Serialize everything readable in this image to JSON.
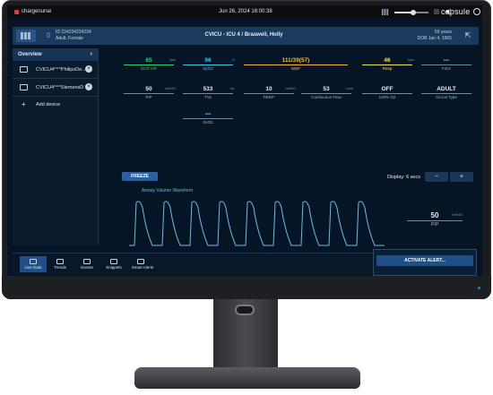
{
  "topbar": {
    "user": "chargenurse",
    "datetime": "Jun 26, 2024  16:00:38",
    "brand": "capsule",
    "brightness_fraction": 0.55
  },
  "patient": {
    "id_line": "ID 234234234234",
    "demo_line": "Adult, Female",
    "location": "CVICU - ICU 4 / Braswell, Holly",
    "age": "59 years",
    "dob": "DOB Jan 4, 1965"
  },
  "sidebar": {
    "title": "Overview",
    "devices": [
      {
        "label": "CVICU4^^^PhilipsDe..."
      },
      {
        "label": "CVICU4^^^SiemensD"
      }
    ],
    "add_label": "Add device"
  },
  "vitals": [
    {
      "value": "65",
      "unit": "bpm",
      "label": "ECG HR",
      "color": "green"
    },
    {
      "value": "96",
      "unit": "%",
      "label": "SpO2",
      "color": "cyan"
    },
    {
      "value": "111/39(57)",
      "unit": "",
      "label": "NIBP",
      "color": "orange"
    },
    {
      "value": "46",
      "unit": "bpm",
      "label": "Resp",
      "color": "yellow"
    },
    {
      "value": "---",
      "unit": "",
      "label": "FiO2",
      "color": ""
    },
    {
      "value": "50",
      "unit": "cmH2O",
      "label": "PIP",
      "color": ""
    },
    {
      "value": "533",
      "unit": "mL",
      "label": "TVe",
      "color": ""
    },
    {
      "value": "10",
      "unit": "cmH2O",
      "label": "PEEP",
      "color": ""
    },
    {
      "value": "53",
      "unit": "L/min",
      "label": "Continuous Flow",
      "color": ""
    },
    {
      "value": "OFF",
      "unit": "",
      "label": "100% O2",
      "color": ""
    },
    {
      "value": "ADULT",
      "unit": "",
      "label": "Circuit Type",
      "color": ""
    },
    {
      "value": "---",
      "unit": "",
      "label": "SvO2",
      "color": ""
    }
  ],
  "controls": {
    "freeze": "FREEZE",
    "display": "Display: 6 secs",
    "minus": "−",
    "plus": "+"
  },
  "waveform": {
    "title": "Airway Volume Waveform",
    "pip_value": "50",
    "pip_unit": "cmH2O",
    "pip_label": "PIP",
    "color": "#5ec0e6"
  },
  "tabs": [
    {
      "label": "Live Data",
      "active": true
    },
    {
      "label": "Trends"
    },
    {
      "label": "Events"
    },
    {
      "label": "Snippets"
    },
    {
      "label": "Smart Alerts"
    }
  ],
  "alert_button": "ACTIVATE ALERT..."
}
